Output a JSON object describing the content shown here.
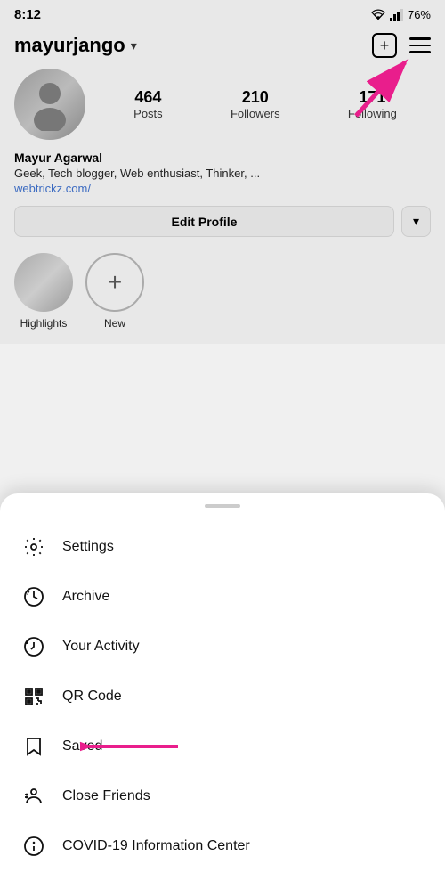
{
  "statusBar": {
    "time": "8:12",
    "battery": "76%"
  },
  "header": {
    "username": "mayurjango",
    "addIconLabel": "+",
    "menuIconLabel": "≡"
  },
  "stats": {
    "posts": {
      "count": "464",
      "label": "Posts"
    },
    "followers": {
      "count": "210",
      "label": "Followers"
    },
    "following": {
      "count": "171",
      "label": "Following"
    }
  },
  "bio": {
    "name": "Mayur Agarwal",
    "description": "Geek, Tech blogger, Web enthusiast, Thinker, ...",
    "link": "webtrickz.com/"
  },
  "editProfile": {
    "label": "Edit Profile",
    "dropdownLabel": "▾"
  },
  "highlights": [
    {
      "id": "highlights",
      "label": "Highlights",
      "type": "existing"
    },
    {
      "id": "new",
      "label": "New",
      "type": "add"
    }
  ],
  "menu": {
    "items": [
      {
        "id": "settings",
        "label": "Settings",
        "icon": "gear"
      },
      {
        "id": "archive",
        "label": "Archive",
        "icon": "archive"
      },
      {
        "id": "your-activity",
        "label": "Your Activity",
        "icon": "activity"
      },
      {
        "id": "qr-code",
        "label": "QR Code",
        "icon": "qr"
      },
      {
        "id": "saved",
        "label": "Saved",
        "icon": "bookmark",
        "hasArrow": true
      },
      {
        "id": "close-friends",
        "label": "Close Friends",
        "icon": "close-friends"
      },
      {
        "id": "covid",
        "label": "COVID-19 Information Center",
        "icon": "info-circle"
      }
    ]
  }
}
